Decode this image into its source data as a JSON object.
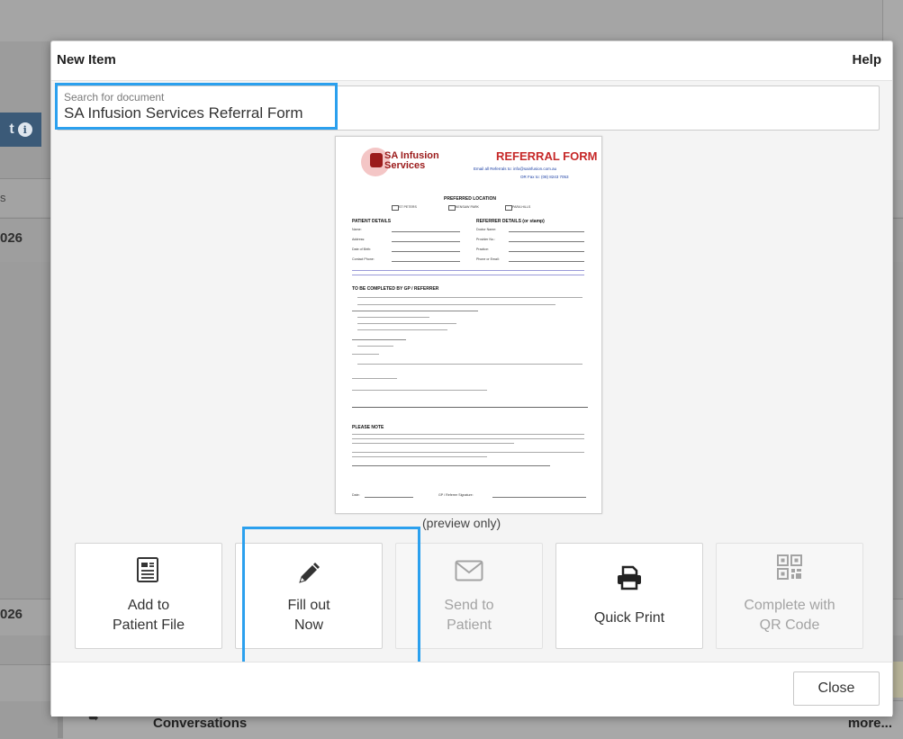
{
  "background": {
    "left_texts": [
      "s",
      "026",
      "026"
    ],
    "conversations_label": "Conversations",
    "more_label": "more..."
  },
  "modal": {
    "title": "New Item",
    "help_label": "Help",
    "search": {
      "label": "Search for document",
      "value": "SA Infusion Services Referral Form"
    },
    "preview": {
      "logo_text_1": "SA Infusion",
      "logo_text_2": "Services",
      "form_title": "REFERRAL FORM",
      "email_line": "Email all Referrals to: info@sainfusion.com.au",
      "fax_line": "OR Fax to: (08) 8243 7053",
      "preferred_location": "PREFERRED LOCATION",
      "locations": [
        "ST PETERS",
        "KENSAW PARK",
        "PARA HILLS"
      ],
      "patient_details": "PATIENT DETAILS",
      "referrer_details": "REFERRER DETAILS (or stamp)",
      "patient_fields": [
        "Name:",
        "Address:",
        "Date of Birth:",
        "Contact Phone:"
      ],
      "referrer_fields": [
        "Doctor Name:",
        "Provider No.:",
        "Practice:",
        "Phone or Email:"
      ],
      "gp_section": "TO BE COMPLETED BY GP / REFERRER",
      "please_note": "PLEASE NOTE",
      "date_label": "Date:",
      "signature_label": "GP / Referrer Signature:"
    },
    "preview_caption": "(preview only)",
    "actions": [
      {
        "line1": "Add to",
        "line2": "Patient File",
        "icon": "document-icon",
        "disabled": false
      },
      {
        "line1": "Fill out",
        "line2": "Now",
        "icon": "pencil-icon",
        "disabled": false
      },
      {
        "line1": "Send to",
        "line2": "Patient",
        "icon": "envelope-icon",
        "disabled": true
      },
      {
        "line1": "Quick Print",
        "line2": "",
        "icon": "printer-icon",
        "disabled": false
      },
      {
        "line1": "Complete with",
        "line2": "QR Code",
        "icon": "qr-code-icon",
        "disabled": true
      }
    ],
    "close_label": "Close"
  },
  "colors": {
    "highlight": "#2ba0ee",
    "form_title_red": "#c62828",
    "disabled_text": "#a3a3a3"
  }
}
